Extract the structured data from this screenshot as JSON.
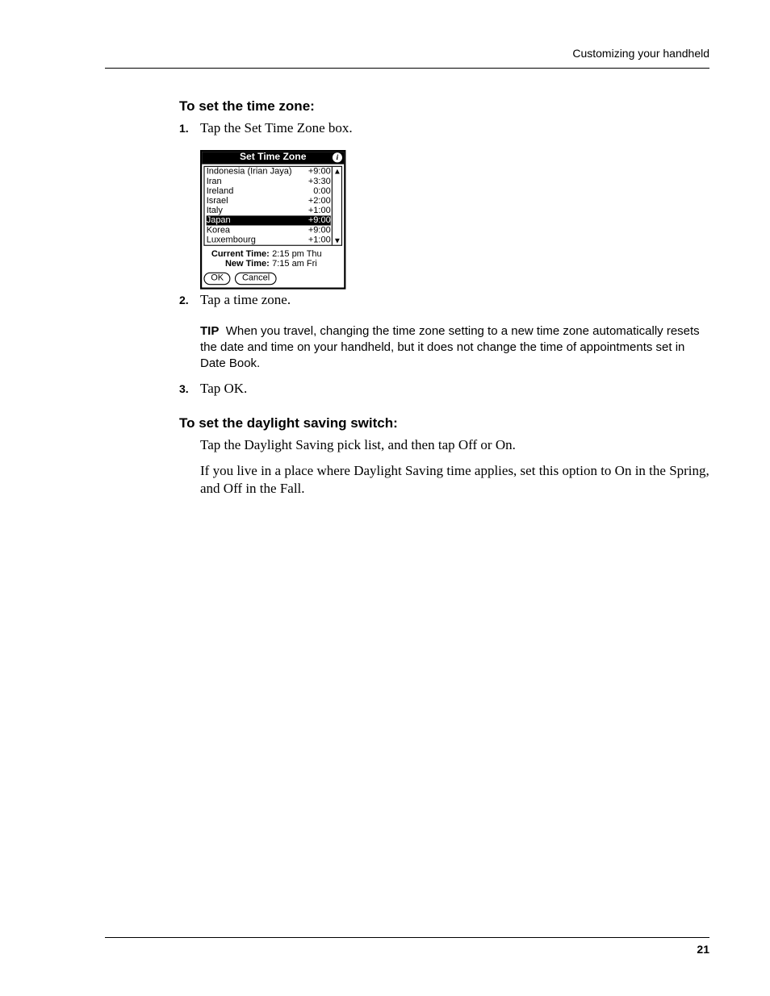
{
  "header": {
    "running_head": "Customizing your handheld"
  },
  "section1": {
    "heading": "To set the time zone:",
    "step1_num": "1.",
    "step1_text": "Tap the Set Time Zone box.",
    "step2_num": "2.",
    "step2_text": "Tap a time zone.",
    "tip_label": "TIP",
    "tip_text": "When you travel, changing the time zone setting to a new time zone automatically resets the date and time on your handheld, but it does not change the time of appointments set in Date Book.",
    "step3_num": "3.",
    "step3_text": "Tap OK."
  },
  "dialog": {
    "title": "Set Time Zone",
    "info_glyph": "i",
    "rows": [
      {
        "name": "Indonesia (Irian Jaya)",
        "offset": "+9:00",
        "selected": false
      },
      {
        "name": "Iran",
        "offset": "+3:30",
        "selected": false
      },
      {
        "name": "Ireland",
        "offset": "0:00",
        "selected": false
      },
      {
        "name": "Israel",
        "offset": "+2:00",
        "selected": false
      },
      {
        "name": "Italy",
        "offset": "+1:00",
        "selected": false
      },
      {
        "name": "Japan",
        "offset": "+9:00",
        "selected": true
      },
      {
        "name": "Korea",
        "offset": "+9:00",
        "selected": false
      },
      {
        "name": "Luxembourg",
        "offset": "+1:00",
        "selected": false
      }
    ],
    "arrow_up": "▲",
    "arrow_down": "▼",
    "current_label": "Current Time:",
    "current_value": "2:15 pm Thu",
    "new_label": "New Time:",
    "new_value": "7:15 am Fri",
    "ok": "OK",
    "cancel": "Cancel"
  },
  "section2": {
    "heading": "To set the daylight saving switch:",
    "p1": "Tap the Daylight Saving pick list, and then tap Off or On.",
    "p2": "If you live in a place where Daylight Saving time applies, set this option to On in the Spring, and Off in the Fall."
  },
  "footer": {
    "page_number": "21"
  }
}
